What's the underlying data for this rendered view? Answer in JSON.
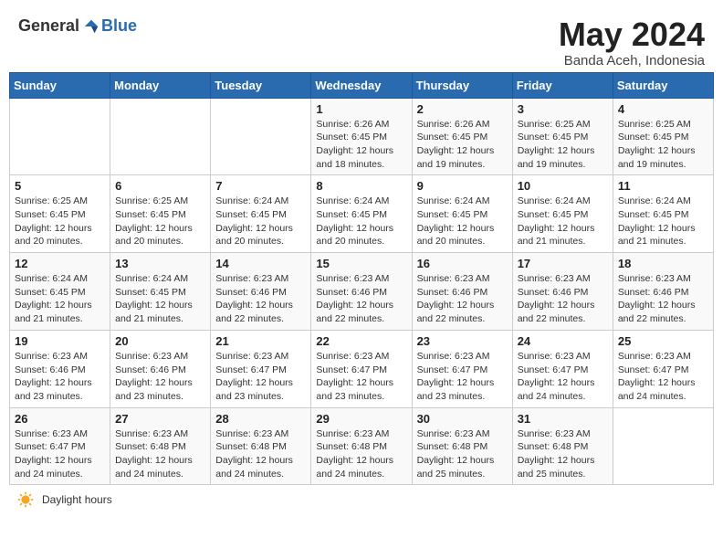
{
  "header": {
    "logo_general": "General",
    "logo_blue": "Blue",
    "month_title": "May 2024",
    "subtitle": "Banda Aceh, Indonesia"
  },
  "days_of_week": [
    "Sunday",
    "Monday",
    "Tuesday",
    "Wednesday",
    "Thursday",
    "Friday",
    "Saturday"
  ],
  "weeks": [
    [
      {
        "day": "",
        "info": ""
      },
      {
        "day": "",
        "info": ""
      },
      {
        "day": "",
        "info": ""
      },
      {
        "day": "1",
        "info": "Sunrise: 6:26 AM\nSunset: 6:45 PM\nDaylight: 12 hours\nand 18 minutes."
      },
      {
        "day": "2",
        "info": "Sunrise: 6:26 AM\nSunset: 6:45 PM\nDaylight: 12 hours\nand 19 minutes."
      },
      {
        "day": "3",
        "info": "Sunrise: 6:25 AM\nSunset: 6:45 PM\nDaylight: 12 hours\nand 19 minutes."
      },
      {
        "day": "4",
        "info": "Sunrise: 6:25 AM\nSunset: 6:45 PM\nDaylight: 12 hours\nand 19 minutes."
      }
    ],
    [
      {
        "day": "5",
        "info": "Sunrise: 6:25 AM\nSunset: 6:45 PM\nDaylight: 12 hours\nand 20 minutes."
      },
      {
        "day": "6",
        "info": "Sunrise: 6:25 AM\nSunset: 6:45 PM\nDaylight: 12 hours\nand 20 minutes."
      },
      {
        "day": "7",
        "info": "Sunrise: 6:24 AM\nSunset: 6:45 PM\nDaylight: 12 hours\nand 20 minutes."
      },
      {
        "day": "8",
        "info": "Sunrise: 6:24 AM\nSunset: 6:45 PM\nDaylight: 12 hours\nand 20 minutes."
      },
      {
        "day": "9",
        "info": "Sunrise: 6:24 AM\nSunset: 6:45 PM\nDaylight: 12 hours\nand 20 minutes."
      },
      {
        "day": "10",
        "info": "Sunrise: 6:24 AM\nSunset: 6:45 PM\nDaylight: 12 hours\nand 21 minutes."
      },
      {
        "day": "11",
        "info": "Sunrise: 6:24 AM\nSunset: 6:45 PM\nDaylight: 12 hours\nand 21 minutes."
      }
    ],
    [
      {
        "day": "12",
        "info": "Sunrise: 6:24 AM\nSunset: 6:45 PM\nDaylight: 12 hours\nand 21 minutes."
      },
      {
        "day": "13",
        "info": "Sunrise: 6:24 AM\nSunset: 6:45 PM\nDaylight: 12 hours\nand 21 minutes."
      },
      {
        "day": "14",
        "info": "Sunrise: 6:23 AM\nSunset: 6:46 PM\nDaylight: 12 hours\nand 22 minutes."
      },
      {
        "day": "15",
        "info": "Sunrise: 6:23 AM\nSunset: 6:46 PM\nDaylight: 12 hours\nand 22 minutes."
      },
      {
        "day": "16",
        "info": "Sunrise: 6:23 AM\nSunset: 6:46 PM\nDaylight: 12 hours\nand 22 minutes."
      },
      {
        "day": "17",
        "info": "Sunrise: 6:23 AM\nSunset: 6:46 PM\nDaylight: 12 hours\nand 22 minutes."
      },
      {
        "day": "18",
        "info": "Sunrise: 6:23 AM\nSunset: 6:46 PM\nDaylight: 12 hours\nand 22 minutes."
      }
    ],
    [
      {
        "day": "19",
        "info": "Sunrise: 6:23 AM\nSunset: 6:46 PM\nDaylight: 12 hours\nand 23 minutes."
      },
      {
        "day": "20",
        "info": "Sunrise: 6:23 AM\nSunset: 6:46 PM\nDaylight: 12 hours\nand 23 minutes."
      },
      {
        "day": "21",
        "info": "Sunrise: 6:23 AM\nSunset: 6:47 PM\nDaylight: 12 hours\nand 23 minutes."
      },
      {
        "day": "22",
        "info": "Sunrise: 6:23 AM\nSunset: 6:47 PM\nDaylight: 12 hours\nand 23 minutes."
      },
      {
        "day": "23",
        "info": "Sunrise: 6:23 AM\nSunset: 6:47 PM\nDaylight: 12 hours\nand 23 minutes."
      },
      {
        "day": "24",
        "info": "Sunrise: 6:23 AM\nSunset: 6:47 PM\nDaylight: 12 hours\nand 24 minutes."
      },
      {
        "day": "25",
        "info": "Sunrise: 6:23 AM\nSunset: 6:47 PM\nDaylight: 12 hours\nand 24 minutes."
      }
    ],
    [
      {
        "day": "26",
        "info": "Sunrise: 6:23 AM\nSunset: 6:47 PM\nDaylight: 12 hours\nand 24 minutes."
      },
      {
        "day": "27",
        "info": "Sunrise: 6:23 AM\nSunset: 6:48 PM\nDaylight: 12 hours\nand 24 minutes."
      },
      {
        "day": "28",
        "info": "Sunrise: 6:23 AM\nSunset: 6:48 PM\nDaylight: 12 hours\nand 24 minutes."
      },
      {
        "day": "29",
        "info": "Sunrise: 6:23 AM\nSunset: 6:48 PM\nDaylight: 12 hours\nand 24 minutes."
      },
      {
        "day": "30",
        "info": "Sunrise: 6:23 AM\nSunset: 6:48 PM\nDaylight: 12 hours\nand 25 minutes."
      },
      {
        "day": "31",
        "info": "Sunrise: 6:23 AM\nSunset: 6:48 PM\nDaylight: 12 hours\nand 25 minutes."
      },
      {
        "day": "",
        "info": ""
      }
    ]
  ],
  "footer": {
    "daylight_label": "Daylight hours"
  }
}
